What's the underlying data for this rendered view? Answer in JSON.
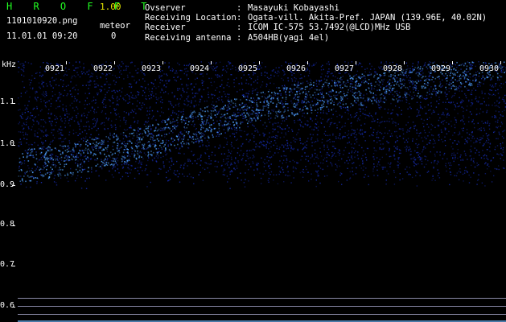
{
  "header": {
    "app_title": "H R O F F T",
    "version": "1.00",
    "filename": "1101010920.png",
    "meteor_label": "meteor",
    "datetime": "11.01.01 09:20",
    "meteor_count": "0",
    "info": [
      {
        "key": "Ovserver",
        "value": "Masayuki Kobayashi"
      },
      {
        "key": "Receiving Location",
        "value": "Ogata-vill. Akita-Pref. JAPAN (139.96E, 40.02N)"
      },
      {
        "key": "Receiver",
        "value": "ICOM IC-575 53.7492(@LCD)MHz USB"
      },
      {
        "key": "Receiving antenna",
        "value": "A504HB(yagi 4el)"
      }
    ]
  },
  "spectrogram": {
    "unit": "kHz",
    "y_ticks": [
      "1.1",
      "1.0",
      "0.9",
      "0.8",
      "0.7",
      "0.6"
    ],
    "time_ticks": [
      "0921",
      "0922",
      "0923",
      "0924",
      "0925",
      "0926",
      "0927",
      "0928",
      "0929",
      "0930"
    ],
    "colors": {
      "noise": "#1428a0",
      "signal": "#50a0ff",
      "background": "#000000"
    }
  }
}
